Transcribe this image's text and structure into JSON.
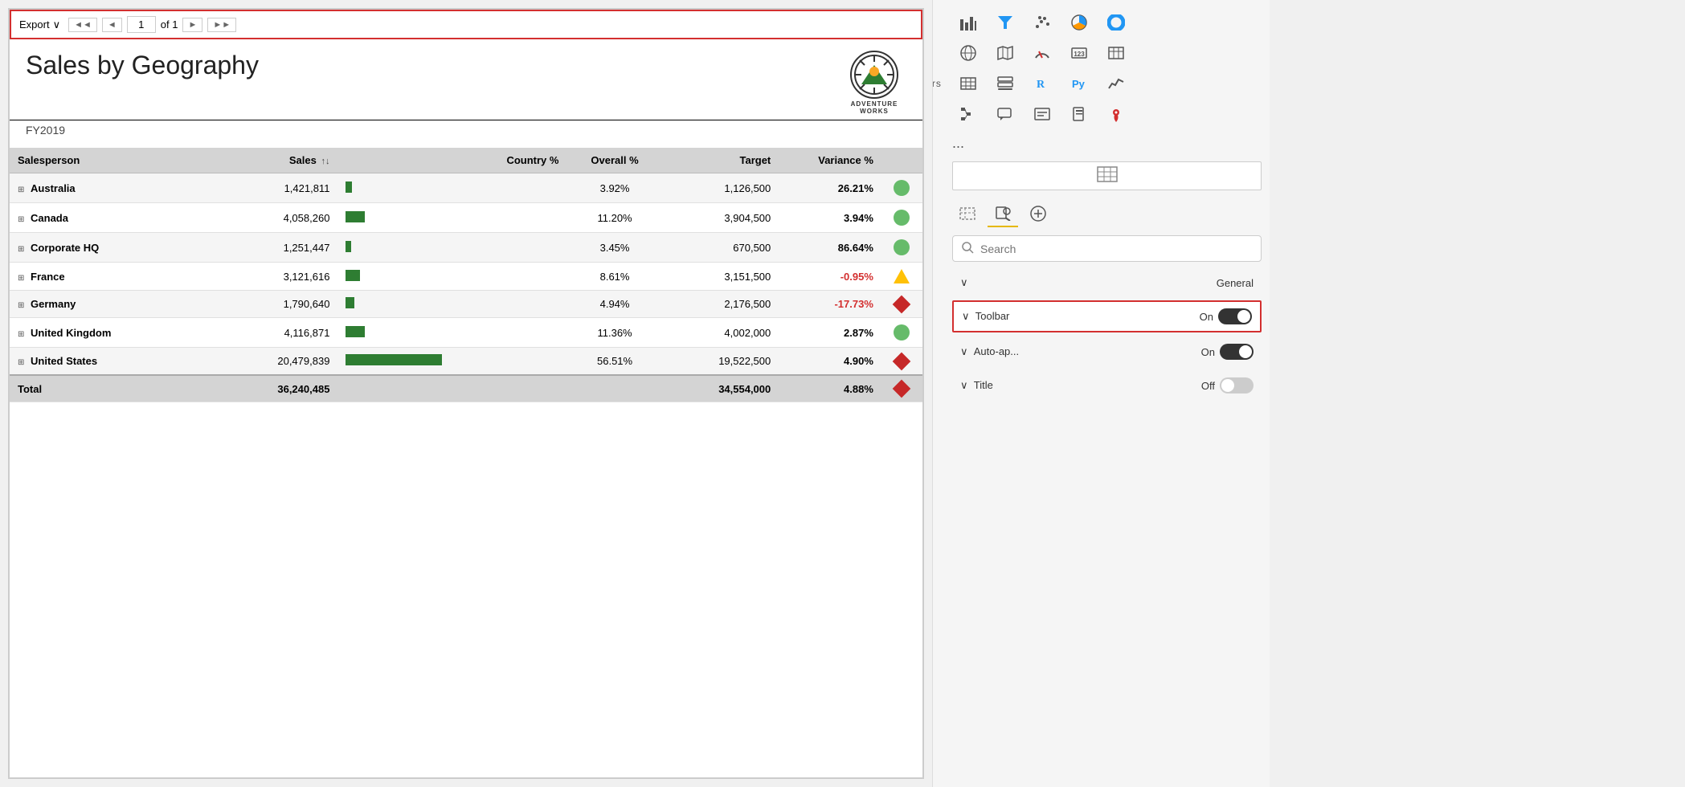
{
  "toolbar": {
    "export_label": "Export",
    "page_current": "1",
    "page_total": "of 1",
    "nav_first": "◄◄",
    "nav_prev": "◄",
    "nav_next": "►",
    "nav_last": "►►"
  },
  "report": {
    "title": "Sales by Geography",
    "subtitle": "FY2019",
    "logo_text": "ADVENTURE\nWORKS"
  },
  "table": {
    "headers": [
      {
        "label": "Salesperson",
        "align": "left"
      },
      {
        "label": "Sales",
        "align": "right",
        "sort": true
      },
      {
        "label": "",
        "align": "left"
      },
      {
        "label": "Country %",
        "align": "center"
      },
      {
        "label": "Overall %",
        "align": "center"
      },
      {
        "label": "Target",
        "align": "right"
      },
      {
        "label": "Variance %",
        "align": "right"
      },
      {
        "label": "",
        "align": "center"
      }
    ],
    "rows": [
      {
        "name": "Australia",
        "sales": "1,421,811",
        "bar_pct": 7,
        "country_pct": "",
        "overall_pct": "3.92%",
        "target": "1,126,500",
        "variance": "26.21%",
        "variance_type": "positive",
        "indicator": "green"
      },
      {
        "name": "Canada",
        "sales": "4,058,260",
        "bar_pct": 20,
        "country_pct": "",
        "overall_pct": "11.20%",
        "target": "3,904,500",
        "variance": "3.94%",
        "variance_type": "positive",
        "indicator": "green"
      },
      {
        "name": "Corporate HQ",
        "sales": "1,251,447",
        "bar_pct": 6,
        "country_pct": "",
        "overall_pct": "3.45%",
        "target": "670,500",
        "variance": "86.64%",
        "variance_type": "positive",
        "indicator": "green"
      },
      {
        "name": "France",
        "sales": "3,121,616",
        "bar_pct": 15,
        "country_pct": "",
        "overall_pct": "8.61%",
        "target": "3,151,500",
        "variance": "-0.95%",
        "variance_type": "negative",
        "indicator": "triangle"
      },
      {
        "name": "Germany",
        "sales": "1,790,640",
        "bar_pct": 9,
        "country_pct": "",
        "overall_pct": "4.94%",
        "target": "2,176,500",
        "variance": "-17.73%",
        "variance_type": "negative",
        "indicator": "diamond"
      },
      {
        "name": "United Kingdom",
        "sales": "4,116,871",
        "bar_pct": 20,
        "country_pct": "",
        "overall_pct": "11.36%",
        "target": "4,002,000",
        "variance": "2.87%",
        "variance_type": "positive",
        "indicator": "green"
      },
      {
        "name": "United States",
        "sales": "20,479,839",
        "bar_pct": 100,
        "country_pct": "",
        "overall_pct": "56.51%",
        "target": "19,522,500",
        "variance": "4.90%",
        "variance_type": "positive",
        "indicator": "diamond"
      }
    ],
    "total_row": {
      "name": "Total",
      "sales": "36,240,485",
      "target": "34,554,000",
      "variance": "4.88%",
      "indicator": "diamond"
    }
  },
  "right_panel": {
    "filters_label": "Filters",
    "icons_row1": [
      "📊",
      "🔽",
      "⚏",
      "🕐",
      "⭕"
    ],
    "icons_row2": [
      "🌐",
      "🗒",
      "📞",
      "123",
      "⊟"
    ],
    "icons_row3": [
      "⊟",
      "📋",
      "📋",
      "R",
      "Py"
    ],
    "icons_row4": [
      "⊞",
      "💬",
      "📄",
      "📊",
      "📍"
    ],
    "dots": "...",
    "viz_tabs": [
      {
        "label": "⊟",
        "active": false
      },
      {
        "label": "🖌",
        "active": true
      },
      {
        "label": "🔍",
        "active": false
      }
    ],
    "search_placeholder": "Search",
    "sections": [
      {
        "label": "General",
        "expanded": true
      },
      {
        "label": "Toolbar",
        "value": "On",
        "toggle_on": true,
        "highlighted": true
      },
      {
        "label": "Auto-ap...",
        "value": "On",
        "toggle_on": true,
        "highlighted": false
      },
      {
        "label": "Title",
        "value": "Off",
        "toggle_on": false,
        "highlighted": false
      }
    ]
  }
}
